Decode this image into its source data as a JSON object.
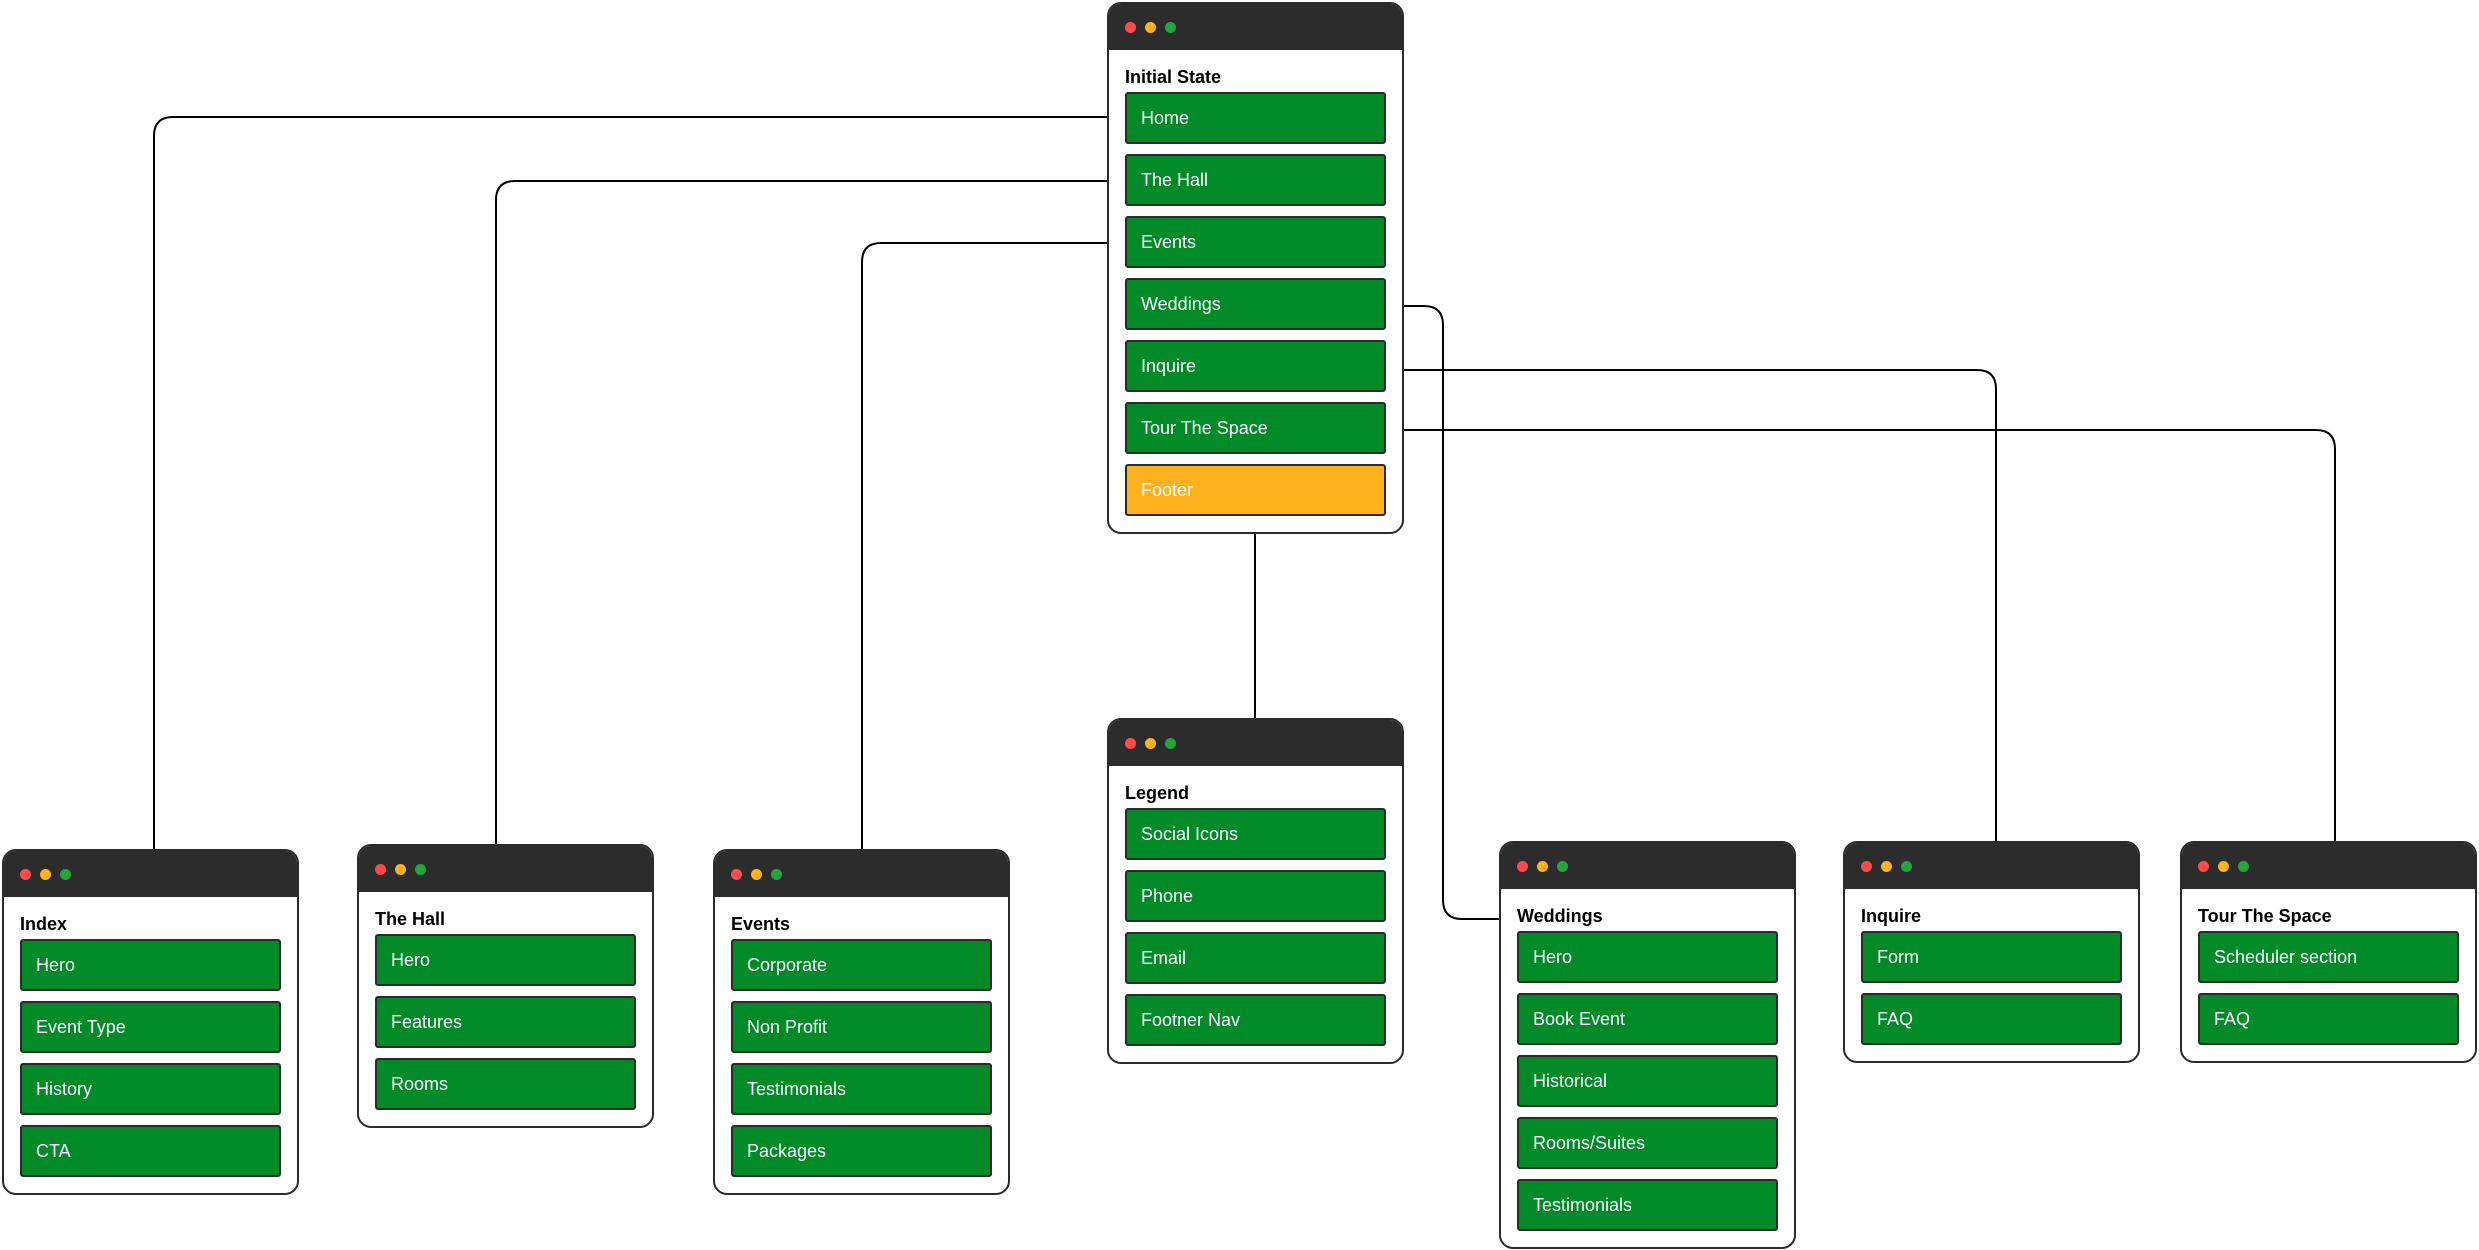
{
  "colors": {
    "item_fill": "#008a28",
    "highlight_fill": "#ffb21e",
    "titlebar": "#2c2c2c",
    "dot_red": "#ff4b4b",
    "dot_yellow": "#ffb21e",
    "dot_green": "#24a53e"
  },
  "initial": {
    "title": "Initial State",
    "items": [
      "Home",
      "The Hall",
      "Events",
      "Weddings",
      "Inquire",
      "Tour The Space",
      "Footer"
    ]
  },
  "legend": {
    "title": "Legend",
    "items": [
      "Social Icons",
      "Phone",
      "Email",
      "Footner Nav"
    ]
  },
  "index": {
    "title": "Index",
    "items": [
      "Hero",
      "Event Type",
      "History",
      "CTA"
    ]
  },
  "hall": {
    "title": "The Hall",
    "items": [
      "Hero",
      "Features",
      "Rooms"
    ]
  },
  "events": {
    "title": "Events",
    "items": [
      "Corporate",
      "Non Profit",
      "Testimonials",
      "Packages"
    ]
  },
  "weddings": {
    "title": "Weddings",
    "items": [
      "Hero",
      "Book Event",
      "Historical",
      "Rooms/Suites",
      "Testimonials"
    ]
  },
  "inquire": {
    "title": "Inquire",
    "items": [
      "Form",
      "FAQ"
    ]
  },
  "tour": {
    "title": "Tour The Space",
    "items": [
      "Scheduler section",
      "FAQ"
    ]
  },
  "connections": [
    {
      "from": "Initial State / Home",
      "to": "Index"
    },
    {
      "from": "Initial State / The Hall",
      "to": "The Hall"
    },
    {
      "from": "Initial State / Events",
      "to": "Events"
    },
    {
      "from": "Initial State / Weddings",
      "to": "Weddings"
    },
    {
      "from": "Initial State / Inquire",
      "to": "Inquire"
    },
    {
      "from": "Initial State / Tour The Space",
      "to": "Tour The Space"
    },
    {
      "from": "Legend",
      "to": "Initial State / Footer",
      "arrow": true
    }
  ]
}
